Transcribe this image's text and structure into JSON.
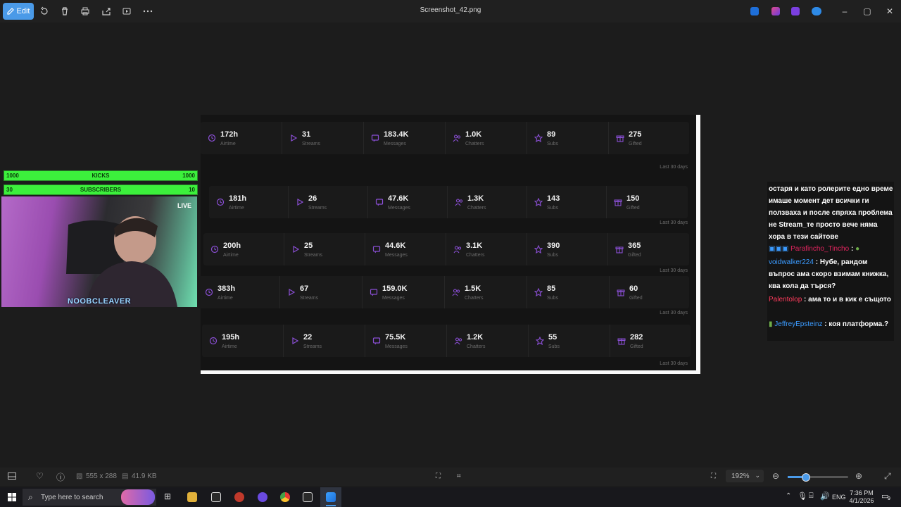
{
  "toolbar": {
    "edit_label": "Edit",
    "file_title": "Screenshot_42.png"
  },
  "stats": {
    "labels": [
      "Airtime",
      "Streams",
      "Messages",
      "Chatters",
      "Subs",
      "Gifted"
    ],
    "last_30_label": "Last 30 days",
    "rows": [
      {
        "values": [
          "172h",
          "31",
          "183.4K",
          "1.0K",
          "89",
          "275"
        ]
      },
      {
        "values": [
          "181h",
          "26",
          "47.6K",
          "1.3K",
          "143",
          "150"
        ]
      },
      {
        "values": [
          "200h",
          "25",
          "44.6K",
          "3.1K",
          "390",
          "365"
        ]
      },
      {
        "values": [
          "383h",
          "67",
          "159.0K",
          "1.5K",
          "85",
          "60"
        ]
      },
      {
        "values": [
          "195h",
          "22",
          "75.5K",
          "1.2K",
          "55",
          "282"
        ]
      }
    ],
    "accent_color": "#8b4fd6"
  },
  "overlay": {
    "kicks": {
      "left": "1000",
      "label": "KICKS",
      "right": "1000"
    },
    "subscribers": {
      "left": "30",
      "label": "SUBSCRIBERS",
      "right": "10"
    },
    "live_label": "LIVE",
    "streamer_name": "NOOBCLEAVER",
    "bar_color": "#3cf03c"
  },
  "chat": {
    "messages": [
      {
        "user": "",
        "text": "остаря и като ролерите едно време имаше момент дет всички ги ползваха и после спряха проблема не Stream_те просто вече няма хора в тези сайтове",
        "color": "#ffffff"
      },
      {
        "user": "Parafincho_Tincho",
        "text": ":",
        "color": "#e0245e"
      },
      {
        "user": "voidwalker224",
        "text": ": Нубе, рандом въпрос ама скоро взимам книжка, ква кола да търся?",
        "color": "#3b9bff"
      },
      {
        "user": "Palentolop",
        "text": ": ама то и в кик е същото",
        "color": "#ff3b5c"
      },
      {
        "user": "JeffreyEpsteinz",
        "text": ": коя платформа.?",
        "color": "#3b9bff"
      }
    ]
  },
  "infobar": {
    "dimensions": "555 x 288",
    "file_size": "41.9 KB",
    "zoom": "192%"
  },
  "taskbar": {
    "search_placeholder": "Type here to search",
    "language": "ENG",
    "time": "7:36 PM",
    "date": "4/1/2026",
    "notification_count": "9"
  }
}
